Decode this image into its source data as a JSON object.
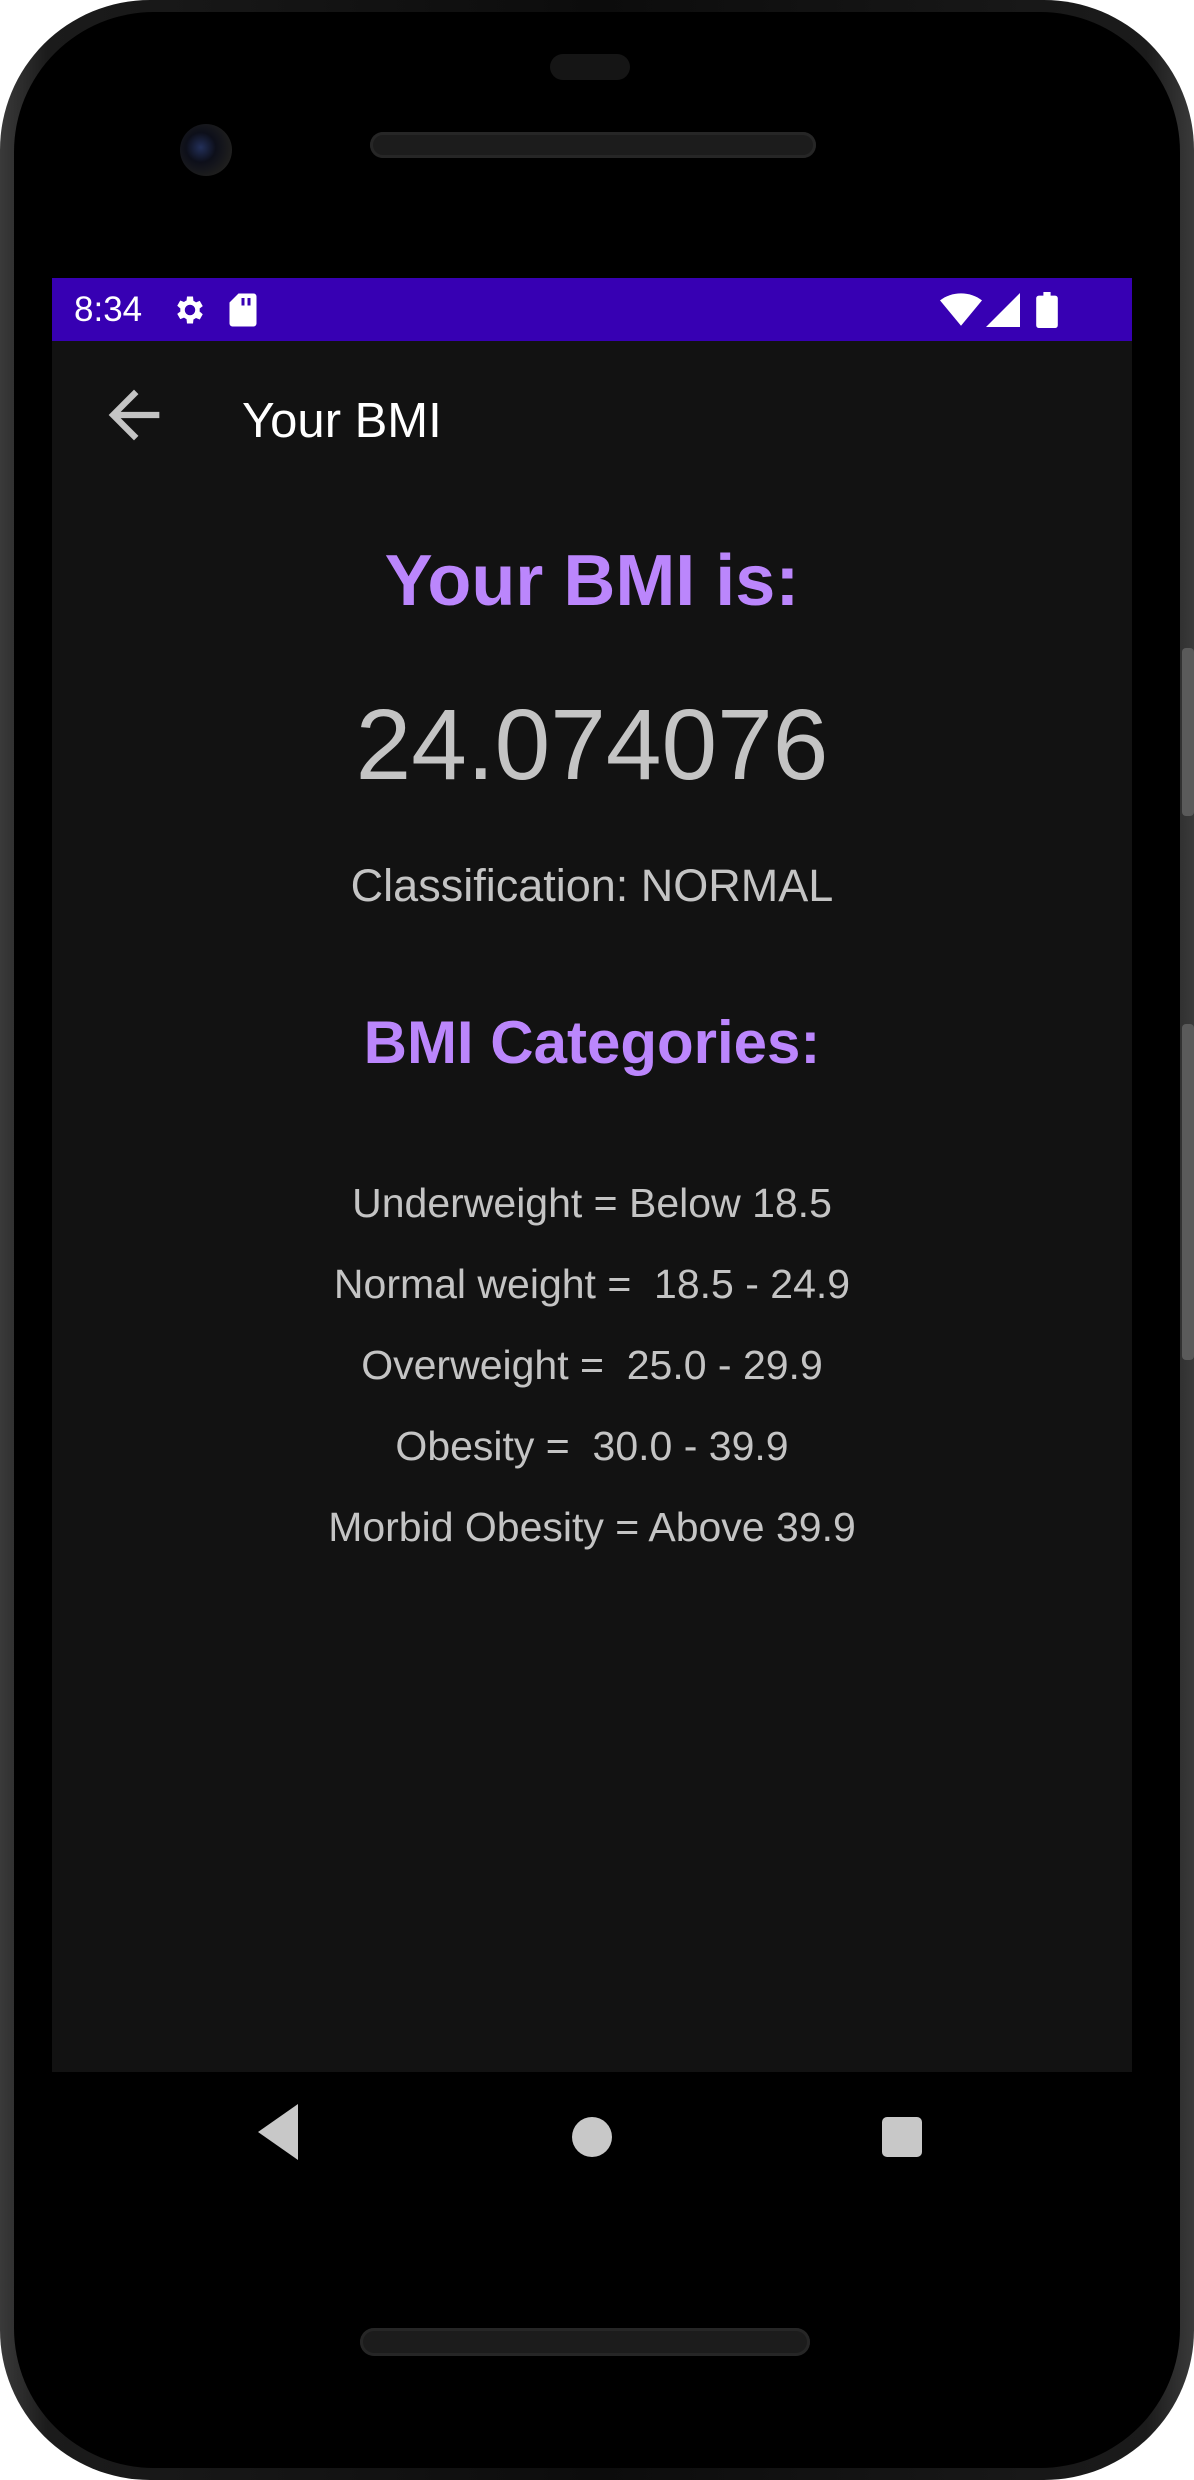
{
  "status_bar": {
    "time": "8:34",
    "icons": [
      "gear-icon",
      "sd-card-icon",
      "wifi-icon",
      "signal-icon",
      "battery-icon"
    ],
    "background": "#3700b3"
  },
  "app_bar": {
    "title": "Your BMI",
    "back_icon": "arrow-left-icon"
  },
  "result": {
    "heading": "Your BMI is:",
    "value": "24.074076",
    "classification": "Classification: NORMAL"
  },
  "categories": {
    "heading": "BMI Categories:",
    "items": [
      "Underweight = Below 18.5",
      "Normal weight =  18.5 - 24.9",
      "Overweight =  25.0 - 29.9",
      "Obesity =  30.0 - 39.9",
      "Morbid Obesity = Above 39.9"
    ]
  },
  "nav_bar": {
    "icons": [
      "nav-back-icon",
      "nav-home-icon",
      "nav-recents-icon"
    ]
  },
  "colors": {
    "accent": "#bb86fc",
    "text": "#c4c4c4",
    "screen_background": "#121212"
  }
}
